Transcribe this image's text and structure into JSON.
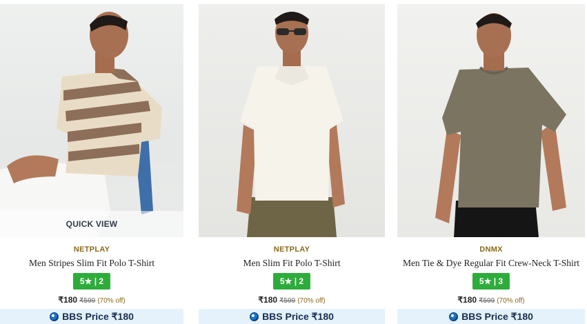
{
  "products": [
    {
      "brand": "NETPLAY",
      "title": "Men Stripes Slim Fit Polo T-Shirt",
      "rating": "5★ | 2",
      "price": "₹180",
      "mrp": "₹599",
      "discount": "(70% off)",
      "bbs_label": "BBS Price ₹180",
      "quick_view": "QUICK VIEW",
      "image_icon": "model-striped-polo-image"
    },
    {
      "brand": "NETPLAY",
      "title": "Men Slim Fit Polo T-Shirt",
      "rating": "5★ | 2",
      "price": "₹180",
      "mrp": "₹599",
      "discount": "(70% off)",
      "bbs_label": "BBS Price ₹180",
      "image_icon": "model-white-polo-image"
    },
    {
      "brand": "DNMX",
      "title": "Men Tie & Dye Regular Fit Crew-Neck T-Shirt",
      "rating": "5★ | 3",
      "price": "₹180",
      "mrp": "₹599",
      "discount": "(70% off)",
      "bbs_label": "BBS Price ₹180",
      "image_icon": "model-olive-tee-image"
    }
  ],
  "colors": {
    "rating_badge": "#2eac3b",
    "brand_text": "#8a6a1a",
    "bbs_bar": "#e5f2fb"
  }
}
